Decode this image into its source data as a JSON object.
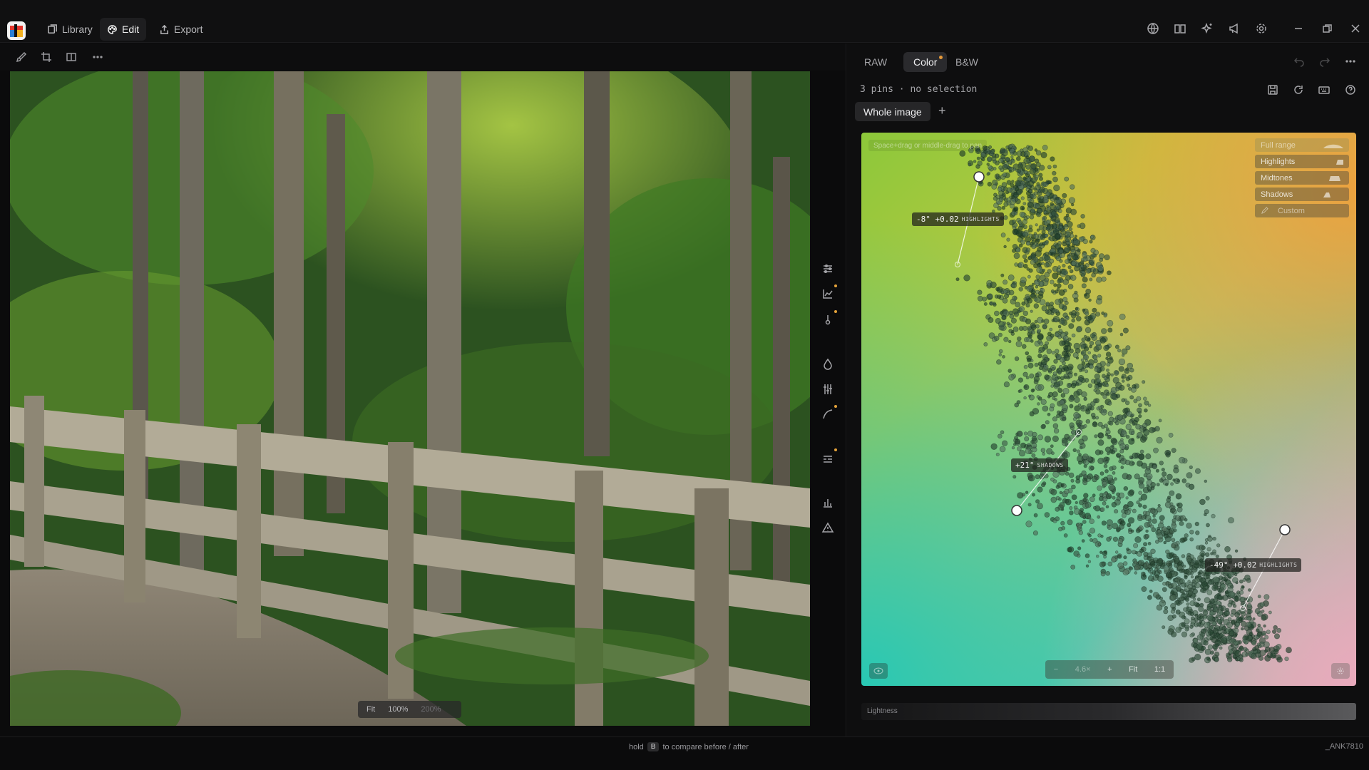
{
  "nav": {
    "library": "Library",
    "edit": "Edit",
    "export": "Export"
  },
  "preview": {
    "zoom_fit": "Fit",
    "zoom_100": "100%",
    "zoom_200": "200%"
  },
  "panel": {
    "tabs": [
      "RAW",
      "Color",
      "B&W"
    ],
    "active_tab": "Color",
    "status": "3 pins · no selection",
    "mask_button": "Whole image",
    "add_mask": "+"
  },
  "plot": {
    "pan_hint": "Space+drag or middle-drag to pan",
    "ranges": [
      "Full range",
      "Highlights",
      "Midtones",
      "Shadows",
      "Custom"
    ],
    "pins": [
      {
        "text": "-8° +0.02",
        "tag": "HIGHLIGHTS"
      },
      {
        "text": "+21°",
        "tag": "SHADOWS"
      },
      {
        "text": "-49° +0.02",
        "tag": "HIGHLIGHTS"
      }
    ],
    "zoom": {
      "minus": "−",
      "value": "4.6×",
      "plus": "+",
      "fit": "Fit",
      "one": "1:1"
    }
  },
  "lightness_label": "Lightness",
  "footer": {
    "hold": "hold",
    "key": "B",
    "compare": "to compare before / after",
    "filename": "_ANK7810"
  },
  "colors": {
    "accent": "#e59a3a",
    "tab_active_bg": "#2a2a2d"
  }
}
